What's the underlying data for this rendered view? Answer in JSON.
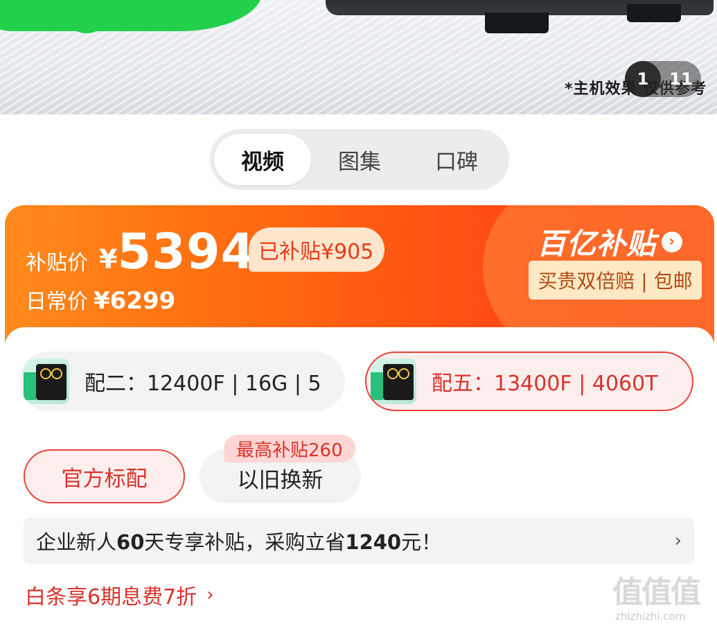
{
  "hero": {
    "disclaimer": "*主机效果 仅供参考",
    "pager_current": "1",
    "pager_total": "11"
  },
  "tabs": [
    {
      "label": "视频",
      "active": true
    },
    {
      "label": "图集",
      "active": false
    },
    {
      "label": "口碑",
      "active": false
    }
  ],
  "price": {
    "subsidy_label": "补贴价",
    "currency": "¥",
    "subsidy_value": "5394",
    "saved_text": "已补贴¥905",
    "daily_label": "日常价",
    "daily_value": "¥6299",
    "brand": "百亿补贴",
    "guarantee": "买贵双倍赔 | 包邮",
    "accent_color": "#ff6a10"
  },
  "variants": [
    {
      "label": "配二：12400F | 16G | 5",
      "selected": false
    },
    {
      "label": "配五：13400F | 4060T",
      "selected": true
    }
  ],
  "options": {
    "official": "官方标配",
    "tradein": "以旧换新",
    "tradein_badge": "最高补贴260"
  },
  "enterprise": {
    "text_a": "企业新人",
    "text_b": "60",
    "text_c": "天专享补贴，采购立省",
    "text_d": "1240",
    "text_e": "元！",
    "arrow": "›"
  },
  "baitiao": {
    "text": "白条享6期息费7折",
    "arrow": "›"
  },
  "watermark": {
    "glyphs": "值值值",
    "site": "zhizhizhi.com"
  }
}
